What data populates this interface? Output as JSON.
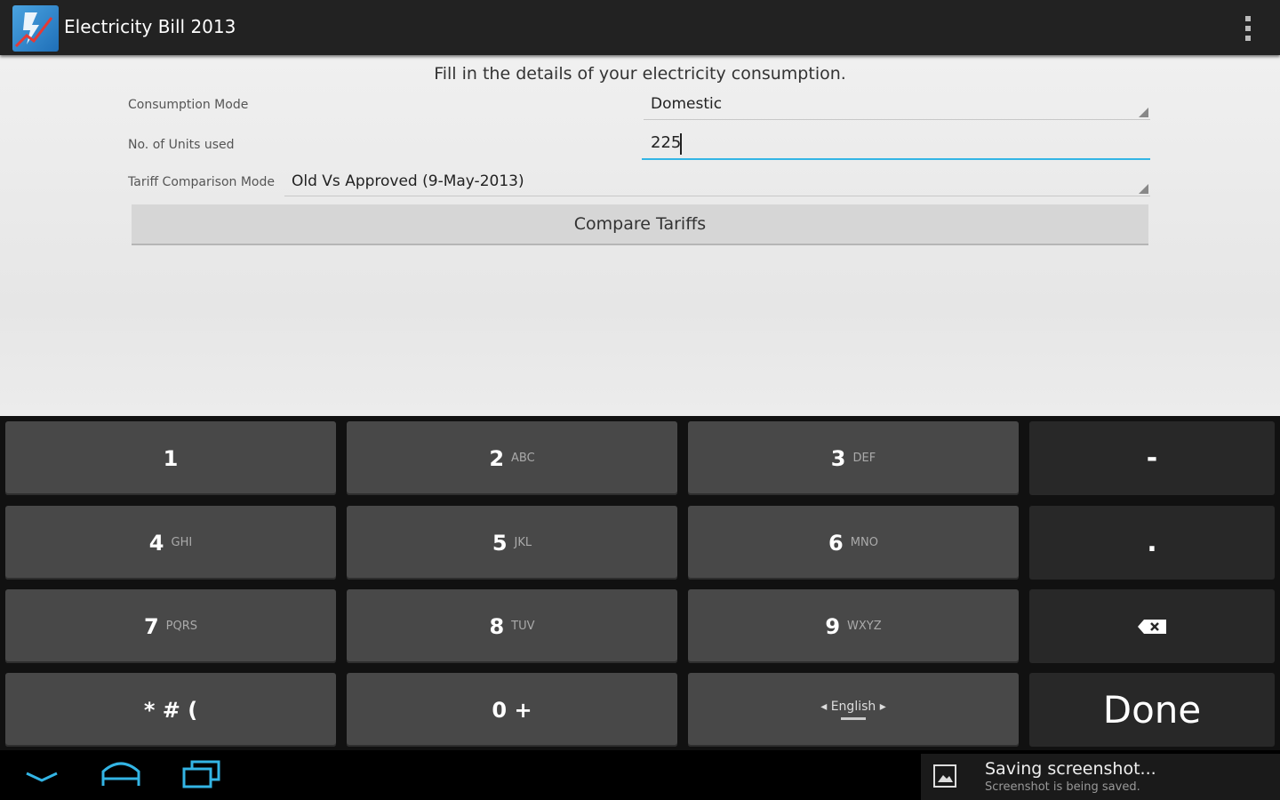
{
  "app": {
    "title": "Electricity Bill 2013"
  },
  "form": {
    "instructions": "Fill in the details of your electricity consumption.",
    "consumption_mode_label": "Consumption Mode",
    "consumption_mode_value": "Domestic",
    "units_label": "No. of Units used",
    "units_value": "225",
    "tariff_mode_label": "Tariff Comparison Mode",
    "tariff_mode_value": "Old Vs Approved (9-May-2013)",
    "compare_button": "Compare Tariffs"
  },
  "keyboard": {
    "keys": [
      {
        "main": "1",
        "sub": ""
      },
      {
        "main": "2",
        "sub": "ABC"
      },
      {
        "main": "3",
        "sub": "DEF"
      },
      {
        "main": "4",
        "sub": "GHI"
      },
      {
        "main": "5",
        "sub": "JKL"
      },
      {
        "main": "6",
        "sub": "MNO"
      },
      {
        "main": "7",
        "sub": "PQRS"
      },
      {
        "main": "8",
        "sub": "TUV"
      },
      {
        "main": "9",
        "sub": "WXYZ"
      },
      {
        "main": "* # (",
        "sub": ""
      },
      {
        "main": "0 +",
        "sub": ""
      }
    ],
    "language": "◂ English ▸",
    "minus": "-",
    "period": ".",
    "done": "Done"
  },
  "notification": {
    "title": "Saving screenshot...",
    "text": "Screenshot is being saved."
  },
  "colors": {
    "accent": "#33b5e5",
    "action_bar": "#222222",
    "key": "#484848",
    "function_key": "#282828"
  }
}
